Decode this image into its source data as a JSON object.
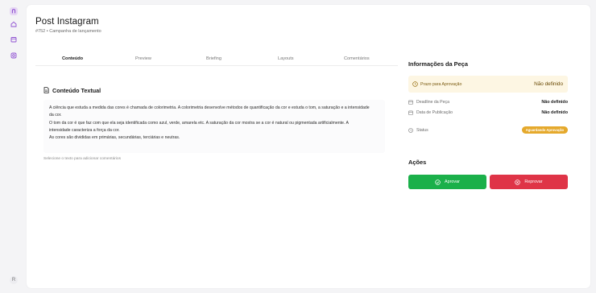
{
  "header": {
    "title": "Post Instagram",
    "subtitle": "#752 • Campanha de lançamento"
  },
  "tabs": [
    {
      "label": "Conteúdo",
      "active": true
    },
    {
      "label": "Preview",
      "active": false
    },
    {
      "label": "Briefing",
      "active": false
    },
    {
      "label": "Layouts",
      "active": false
    },
    {
      "label": "Comentários",
      "active": false
    }
  ],
  "content": {
    "section_title": "Conteúdo Textual",
    "lines": [
      "A ciência que estuda a medida das cores é chamada de colorimetria. A colorimetria desenvolve métodos de quantificação da cor e estuda o tom, a saturação e a intensidade",
      "da cor.",
      "O tom da cor é que faz com que ela seja identificada como azul, verde, amarela etc. A saturação da cor mostra se a cor é natural ou pigmentada artificialmente. A",
      "intensidade caracteriza a força da cor.",
      "As cores são divididas em primárias, secundárias, terciárias e neutras."
    ],
    "hint": "Selecione o texto para adicionar comentários"
  },
  "info": {
    "title": "Informações da Peça",
    "deadline_label": "Prazo para Aprovação",
    "deadline_value": "Não definido",
    "rows": [
      {
        "label": "Deadline da Peça",
        "value": "Não definido"
      },
      {
        "label": "Data de Publicação",
        "value": "Não definido"
      }
    ],
    "status_label": "Status",
    "status_badge": "Aguardando Aprovação"
  },
  "actions": {
    "title": "Ações",
    "approve_label": "Aprovar",
    "reject_label": "Reprovar"
  },
  "sidebar": {
    "avatar_initial": "R"
  },
  "colors": {
    "approve": "#1bb04a",
    "reject": "#df3447",
    "badge": "#e5a92c",
    "deadline_bg": "#fdf6e3",
    "brand": "#8e4fd1"
  },
  "icons": [
    "logo-icon",
    "home-icon",
    "calendar-icon",
    "instagram-icon",
    "document-icon",
    "clock-icon",
    "check-circle-icon",
    "x-circle-icon"
  ]
}
